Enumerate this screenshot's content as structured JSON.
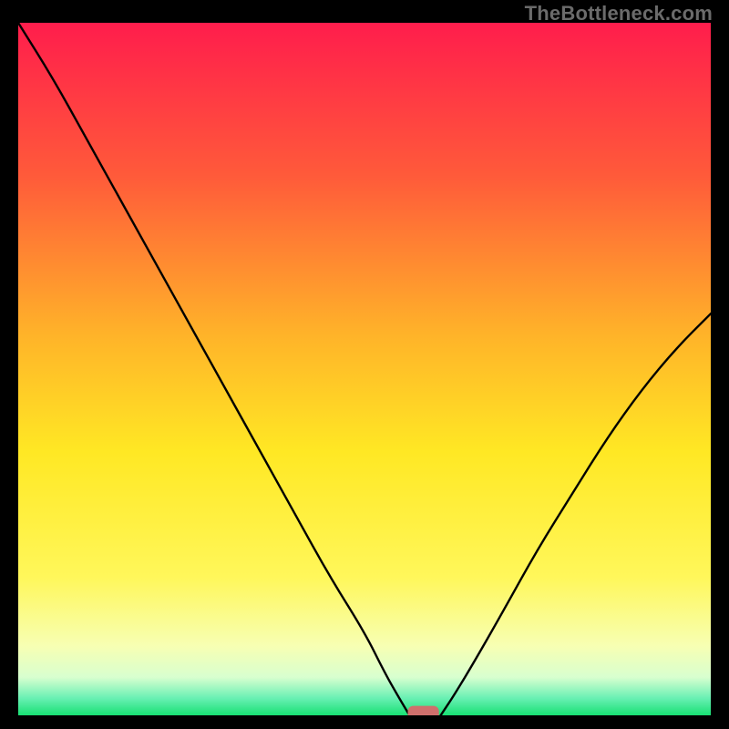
{
  "watermark": "TheBottleneck.com",
  "chart_data": {
    "type": "line",
    "title": "",
    "xlabel": "",
    "ylabel": "",
    "xlim": [
      0,
      100
    ],
    "ylim": [
      0,
      100
    ],
    "grid": false,
    "legend": false,
    "background_gradient": {
      "stops": [
        {
          "offset": 0.0,
          "color": "#ff1d4c"
        },
        {
          "offset": 0.22,
          "color": "#ff5a3a"
        },
        {
          "offset": 0.45,
          "color": "#ffb329"
        },
        {
          "offset": 0.62,
          "color": "#ffe824"
        },
        {
          "offset": 0.8,
          "color": "#fff75a"
        },
        {
          "offset": 0.9,
          "color": "#f7ffb3"
        },
        {
          "offset": 0.945,
          "color": "#d8ffcf"
        },
        {
          "offset": 0.975,
          "color": "#6af0b4"
        },
        {
          "offset": 1.0,
          "color": "#18e073"
        }
      ]
    },
    "series": [
      {
        "name": "left-branch",
        "x": [
          0,
          5,
          10,
          15,
          20,
          25,
          30,
          35,
          40,
          45,
          50,
          53,
          55,
          56.5
        ],
        "values": [
          100,
          92,
          83,
          74,
          65,
          56,
          47,
          38,
          29,
          20,
          12,
          6,
          2.5,
          0
        ]
      },
      {
        "name": "right-branch",
        "x": [
          61,
          63,
          66,
          70,
          75,
          80,
          85,
          90,
          95,
          100
        ],
        "values": [
          0,
          3,
          8,
          15,
          24,
          32,
          40,
          47,
          53,
          58
        ]
      }
    ],
    "marker": {
      "name": "optimal-point",
      "shape": "rounded-rect",
      "x": 58.5,
      "y": 0,
      "width": 4.5,
      "height": 2.2,
      "color": "#cf6f6c"
    },
    "annotations": []
  }
}
